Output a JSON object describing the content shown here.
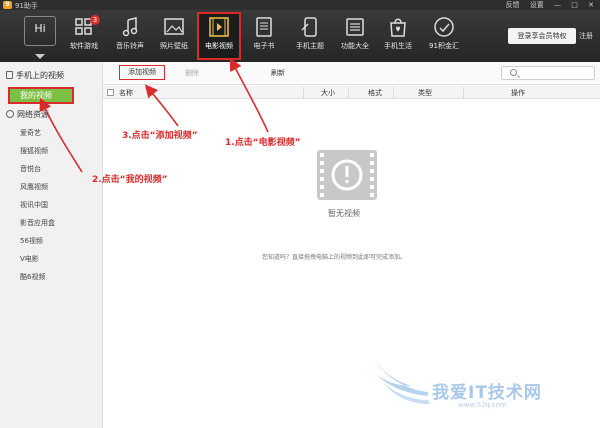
{
  "window": {
    "title": "91助手",
    "links": [
      "反馈",
      "设置",
      "—",
      "□",
      "✕"
    ]
  },
  "toolbar": {
    "tools": [
      {
        "label": "软件游戏",
        "icon": "apps-grid-icon",
        "badge": "3"
      },
      {
        "label": "音乐铃声",
        "icon": "music-note-icon"
      },
      {
        "label": "照片壁纸",
        "icon": "photo-icon"
      },
      {
        "label": "电影视频",
        "icon": "film-icon",
        "active": true
      },
      {
        "label": "电子书",
        "icon": "ebook-icon"
      },
      {
        "label": "手机主题",
        "icon": "theme-icon"
      },
      {
        "label": "功能大全",
        "icon": "functions-icon"
      },
      {
        "label": "手机生活",
        "icon": "shopping-bag-icon"
      },
      {
        "label": "91积金汇",
        "icon": "coin-icon"
      }
    ],
    "device_label": "Hi",
    "login_label": "登录享会员特权",
    "register_label": "注册"
  },
  "sidebar": {
    "phone_section": "手机上的视频",
    "my_videos": "我的视频",
    "net_section": "网络资源",
    "items": [
      "爱奇艺",
      "搜狐视频",
      "音悦台",
      "风鹰视频",
      "视讯中国",
      "影音应用盒",
      "56视频",
      "V电影",
      "酷6视频"
    ]
  },
  "actions": {
    "add": "添加视频",
    "delete": "删除",
    "refresh": "刷新",
    "search_placeholder": ""
  },
  "table": {
    "columns": [
      "名称",
      "大小",
      "格式",
      "类型",
      "操作"
    ]
  },
  "empty": {
    "label": "暂无视频",
    "tip": "您知道吗？直接拖拽电脑上的视频到此即可完成添加。"
  },
  "annotations": {
    "step1": "1.点击“电影视频”",
    "step2": "2.点击“我的视频”",
    "step3": "3.点击“添加视频”"
  },
  "watermark": {
    "text": "我爱IT技术网",
    "url": "www.52ij.com"
  },
  "colors": {
    "accent_red": "#d92b2b",
    "selected_green": "#7cc143",
    "toolbar_bg": "#2b2b2b"
  }
}
